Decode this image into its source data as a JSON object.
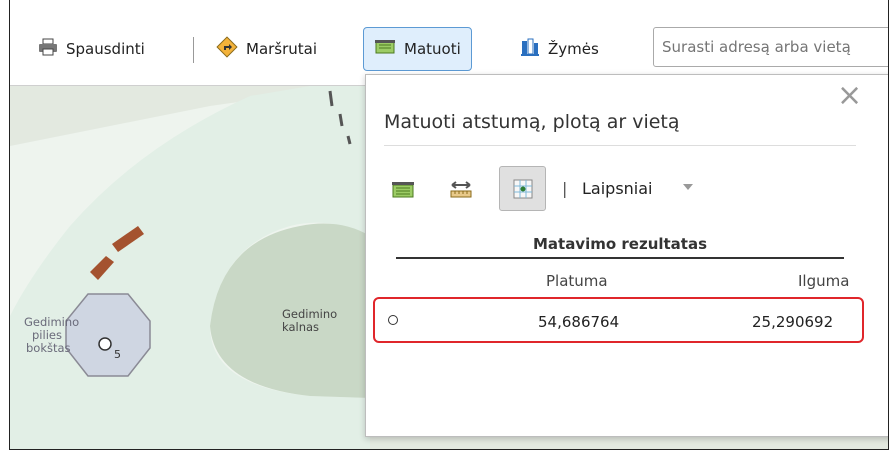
{
  "toolbar": {
    "print_label": "Spausdinti",
    "routes_label": "Maršrutai",
    "measure_label": "Matuoti",
    "bookmarks_label": "Žymės",
    "search_placeholder": "Surasti adresą arba vietą"
  },
  "map": {
    "poi_name_lines": [
      "Gedimino",
      "pilies",
      "bokštas"
    ],
    "poi_marker": "5",
    "hill_name_lines": [
      "Gedimino",
      "kalnas"
    ]
  },
  "measure_panel": {
    "title": "Matuoti atstumą, plotą ar vietą",
    "close_symbol": "×",
    "unit_separator": "|",
    "unit": "Laipsniai",
    "result_header": "Matavimo rezultatas",
    "columns": {
      "latitude": "Platuma",
      "longitude": "Ilguma"
    },
    "result": {
      "latitude": "54,686764",
      "longitude": "25,290692"
    }
  }
}
